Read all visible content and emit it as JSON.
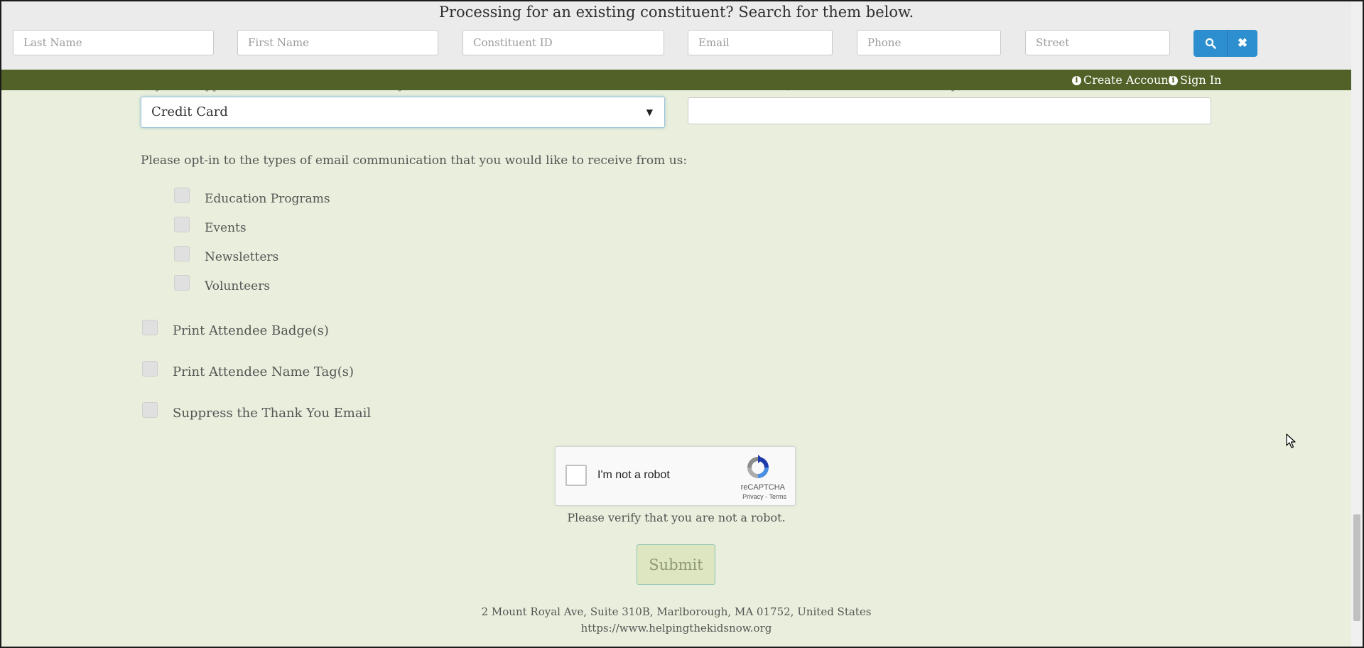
{
  "search": {
    "title": "Processing for an existing constituent? Search for them below.",
    "fields": [
      {
        "placeholder": "Last Name",
        "value": ""
      },
      {
        "placeholder": "First Name",
        "value": ""
      },
      {
        "placeholder": "Constituent ID",
        "value": ""
      },
      {
        "placeholder": "Email",
        "value": ""
      },
      {
        "placeholder": "Phone",
        "value": ""
      },
      {
        "placeholder": "Street",
        "value": ""
      }
    ],
    "search_icon": "search-icon",
    "clear_icon": "close-icon",
    "search_glyph": "⚲",
    "clear_glyph": "✖"
  },
  "account_bar": {
    "create_account": "Create Account",
    "sign_in": "Sign In",
    "info_glyph": "i",
    "color": "#526127"
  },
  "form": {
    "payment_type_label": "Payment Type (Field Not Visible Externally)",
    "payment_type_value": "Credit Card",
    "caret": "▼",
    "check_number_label": "Check Number (Field Not Visible Externally)",
    "check_number_value": "",
    "optin_prompt": "Please opt-in to the types of email communication that you would like to receive from us:",
    "optin_options": [
      {
        "label": "Education Programs",
        "checked": false
      },
      {
        "label": "Events",
        "checked": false
      },
      {
        "label": "Newsletters",
        "checked": false
      },
      {
        "label": "Volunteers",
        "checked": false
      }
    ],
    "print_badges": {
      "label": "Print Attendee Badge(s)",
      "checked": false
    },
    "print_name_tags": {
      "label": "Print Attendee Name Tag(s)",
      "checked": false
    },
    "suppress_thank_you": {
      "label": "Suppress the Thank You Email",
      "checked": false
    }
  },
  "recaptcha": {
    "label": "I'm not a robot",
    "brand": "reCAPTCHA",
    "links": "Privacy - Terms",
    "verify_message": "Please verify that you are not a robot."
  },
  "submit_label": "Submit",
  "footer": {
    "address": "2 Mount Royal Ave, Suite 310B, Marlborough, MA 01752, United States",
    "url": "https://www.helpingthekidsnow.org"
  },
  "colors": {
    "page_bg": "#e9efdc",
    "search_button": "#2d8fcf",
    "submit_bg": "#dde5c1"
  }
}
